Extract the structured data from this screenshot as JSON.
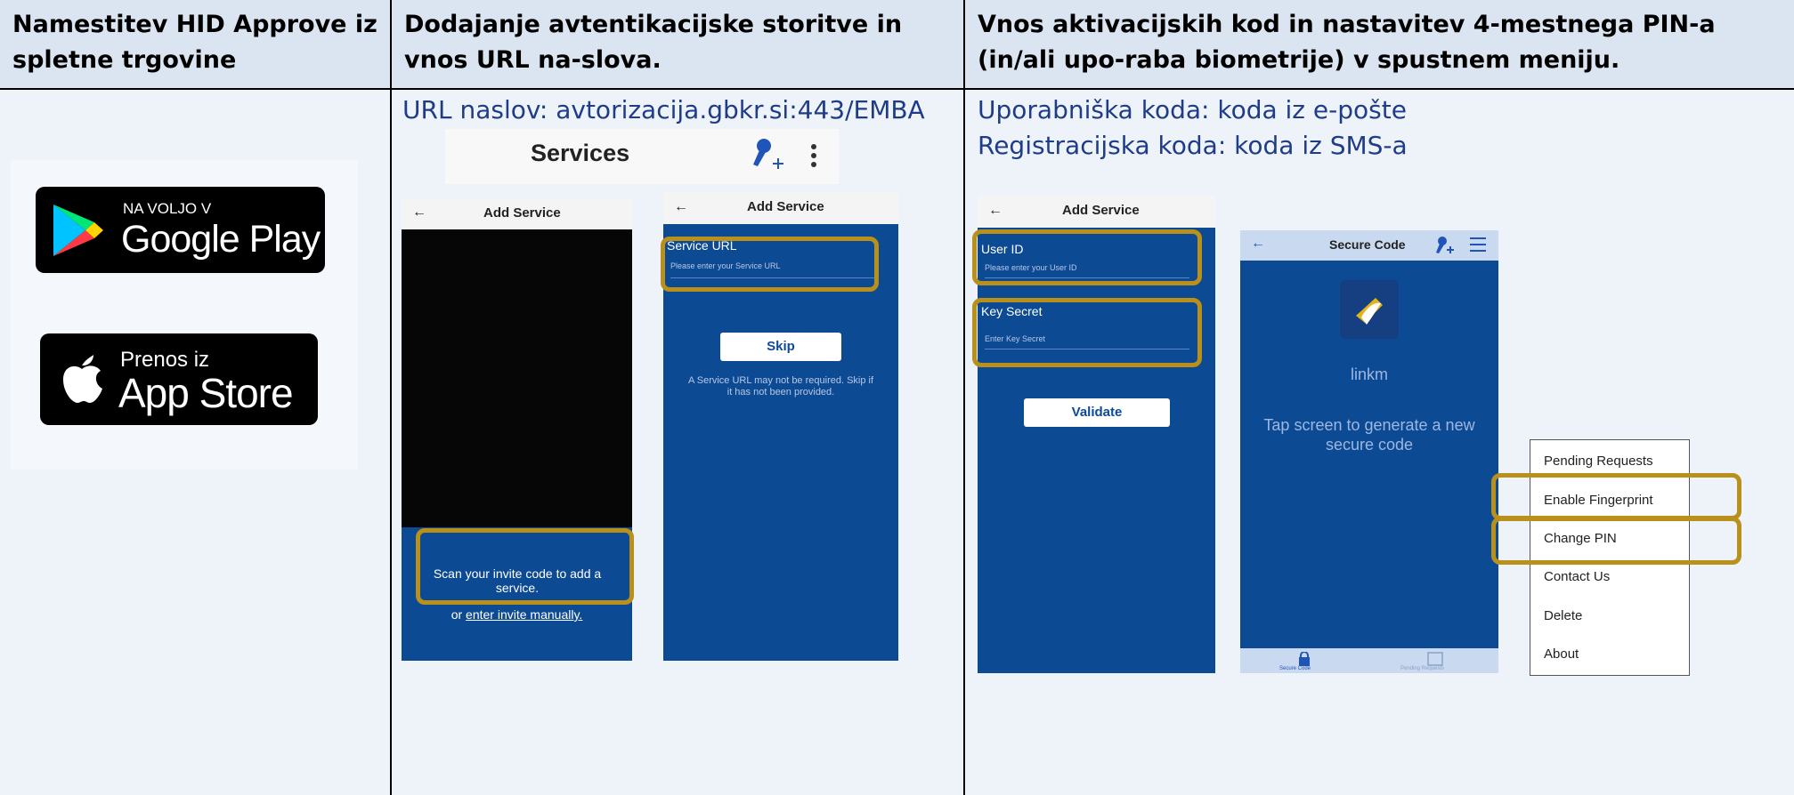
{
  "columns": [
    {
      "header": "Namestitev HID Approve iz spletne trgovine"
    },
    {
      "header": "Dodajanje avtentikacijske storitve in vnos URL na-slova.",
      "url_label": "URL naslov: avtorizacija.gbkr.si:443/EMBA"
    },
    {
      "header": "Vnos aktivacijskih kod in nastavitev 4-mestnega PIN-a (in/ali upo-raba biometrije) v spustnem meniju.",
      "user_code": "Uporabniška koda: koda iz e-pošte",
      "reg_code": "Registracijska koda: koda iz SMS-a"
    }
  ],
  "badges": {
    "google_small": "NA VOLJO V",
    "google_big": "Google Play",
    "apple_small": "Prenos iz",
    "apple_big": "App Store"
  },
  "services_screen": {
    "title": "Services"
  },
  "add_service_scan": {
    "title": "Add Service",
    "scan_text": "Scan your invite code to add a service.",
    "or_text": "or",
    "manual_link": "enter invite manually."
  },
  "add_service_url": {
    "title": "Add Service",
    "field_label": "Service URL",
    "placeholder": "Please enter your Service URL",
    "skip": "Skip",
    "note": "A Service URL may not be required. Skip if it has not been provided."
  },
  "add_service_codes": {
    "title": "Add Service",
    "user_id_label": "User ID",
    "user_id_placeholder": "Please enter your User ID",
    "key_label": "Key Secret",
    "key_placeholder": "Enter Key Secret",
    "validate": "Validate"
  },
  "secure_code": {
    "title": "Secure Code",
    "app_name": "linkm",
    "tap_text": "Tap screen to generate a new secure code",
    "bottom_left": "Secure Code",
    "bottom_right": "Pending Requests"
  },
  "menu": {
    "items": [
      "Pending Requests",
      "Enable Fingerprint",
      "Change PIN",
      "Contact Us",
      "Delete",
      "About"
    ]
  },
  "colors": {
    "header_bg": "#dbe5f1",
    "body_bg": "#eef3fa",
    "app_blue": "#0d4a94",
    "highlight": "#b8901a",
    "text_blue": "#1f3c88"
  }
}
